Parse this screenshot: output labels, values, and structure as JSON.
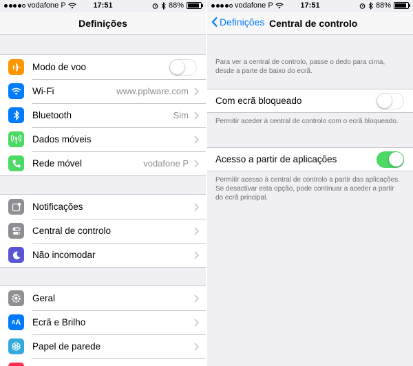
{
  "status_left": {
    "carrier": "vodafone P",
    "time": "17:51",
    "battery": "88%",
    "battery_level": 0.88
  },
  "status_right": {
    "carrier": "vodafone P",
    "time": "17:51",
    "battery": "88%",
    "battery_level": 0.88
  },
  "left": {
    "title": "Definições",
    "group1": [
      {
        "label": "Modo de voo",
        "icon": "airplane-icon",
        "color": "#ff9500",
        "toggle": false
      },
      {
        "label": "Wi-Fi",
        "icon": "wifi-icon",
        "color": "#007aff",
        "value": "www.pplware.com"
      },
      {
        "label": "Bluetooth",
        "icon": "bluetooth-icon",
        "color": "#007aff",
        "value": "Sim"
      },
      {
        "label": "Dados móveis",
        "icon": "cellular-icon",
        "color": "#4cd964",
        "value": ""
      },
      {
        "label": "Rede móvel",
        "icon": "phone-icon",
        "color": "#4cd964",
        "value": "vodafone P"
      }
    ],
    "group2": [
      {
        "label": "Notificações",
        "icon": "notifications-icon",
        "color": "#8e8e93"
      },
      {
        "label": "Central de controlo",
        "icon": "control-center-icon",
        "color": "#8e8e93"
      },
      {
        "label": "Não incomodar",
        "icon": "moon-icon",
        "color": "#5856d6"
      }
    ],
    "group3": [
      {
        "label": "Geral",
        "icon": "gear-icon",
        "color": "#8e8e93"
      },
      {
        "label": "Ecrã e Brilho",
        "icon": "brightness-icon",
        "color": "#007aff"
      },
      {
        "label": "Papel de parede",
        "icon": "wallpaper-icon",
        "color": "#007aff"
      }
    ]
  },
  "right": {
    "back_label": "Definições",
    "title": "Central de controlo",
    "intro": "Para ver a central de controlo, passe o dedo para cima, desde a parte de baixo do ecrã.",
    "lock_screen": {
      "label": "Com ecrã bloqueado",
      "on": false,
      "note": "Permitir aceder à central de controlo com o ecrã bloqueado."
    },
    "within_apps": {
      "label": "Acesso a partir de aplicações",
      "on": true,
      "note": "Permitir acesso à central de controlo a partir das aplicações. Se desactivar esta opção, pode continuar a aceder a partir do ecrã principal."
    }
  },
  "colors": {
    "accent": "#007aff",
    "toggle_on": "#4cd964",
    "separator": "#c8c7cc",
    "background": "#efeff4"
  }
}
